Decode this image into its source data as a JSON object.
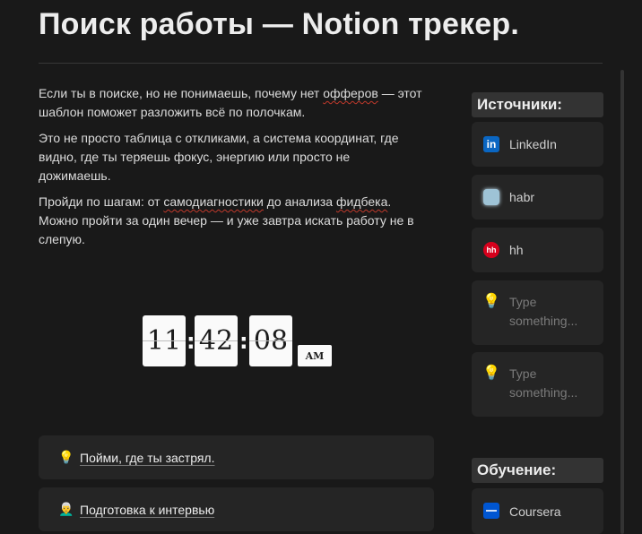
{
  "page": {
    "title": "Поиск работы — Notion трекер."
  },
  "intro": {
    "p1_a": "Если ты в поиске, но не понимаешь, почему нет ",
    "p1_link": "офферов",
    "p1_b": " — этот шаблон поможет разложить всё по полочкам.",
    "p2": "Это не просто таблица с откликами, а система координат, где видно, где ты теряешь фокус, энергию или просто не дожимаешь.",
    "p3_a": "Пройди по шагам: от ",
    "p3_link1": "самодиагностики",
    "p3_b": " до анализа ",
    "p3_link2": "фидбека",
    "p3_c": ". Можно пройти за один вечер — и уже завтра искать работу не в слепую."
  },
  "clock": {
    "hours": "11",
    "minutes": "42",
    "seconds": "08",
    "ampm": "AM"
  },
  "toggles": [
    {
      "icon": "lightbulb-icon",
      "label": "Пойми, где ты застрял."
    },
    {
      "icon": "person-emoji-icon",
      "label": "Подготовка к интервью"
    }
  ],
  "sidebar": {
    "sources_title": "Источники:",
    "sources": [
      {
        "icon": "linkedin-icon",
        "label": "LinkedIn"
      },
      {
        "icon": "habr-icon",
        "label": "habr"
      },
      {
        "icon": "hh-icon",
        "label": "hh"
      },
      {
        "icon": "lightbulb-icon",
        "label": "Type something..."
      },
      {
        "icon": "lightbulb-icon",
        "label": "Type something..."
      }
    ],
    "learning_title": "Обучение:",
    "learning": [
      {
        "icon": "coursera-icon",
        "label": "Coursera"
      }
    ]
  },
  "colors": {
    "background": "#191919",
    "card": "#252525",
    "header": "#333333",
    "linkedin": "#0a66c2",
    "hh": "#d6001c",
    "coursera": "#0056d2"
  }
}
